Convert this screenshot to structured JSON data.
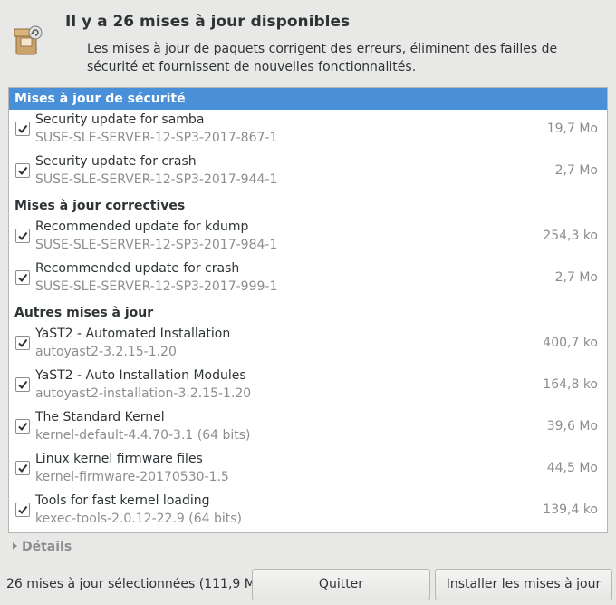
{
  "header": {
    "title": "Il y a 26 mises à jour disponibles",
    "description": "Les mises à jour de paquets corrigent des erreurs, éliminent des failles de sécurité et fournissent de nouvelles fonctionnalités.",
    "icon": "software-update-icon"
  },
  "groups": [
    {
      "title": "Mises à jour de sécurité",
      "selected": true,
      "items": [
        {
          "name": "Security update for samba",
          "id": "SUSE-SLE-SERVER-12-SP3-2017-867-1",
          "size": "19,7 Mo",
          "checked": true
        },
        {
          "name": "Security update for crash",
          "id": "SUSE-SLE-SERVER-12-SP3-2017-944-1",
          "size": "2,7 Mo",
          "checked": true
        }
      ]
    },
    {
      "title": "Mises à jour correctives",
      "selected": false,
      "items": [
        {
          "name": "Recommended update for kdump",
          "id": "SUSE-SLE-SERVER-12-SP3-2017-984-1",
          "size": "254,3 ko",
          "checked": true
        },
        {
          "name": "Recommended update for crash",
          "id": "SUSE-SLE-SERVER-12-SP3-2017-999-1",
          "size": "2,7 Mo",
          "checked": true
        }
      ]
    },
    {
      "title": "Autres mises à jour",
      "selected": false,
      "items": [
        {
          "name": "YaST2 - Automated Installation",
          "id": "autoyast2-3.2.15-1.20",
          "size": "400,7 ko",
          "checked": true
        },
        {
          "name": "YaST2 - Auto Installation Modules",
          "id": "autoyast2-installation-3.2.15-1.20",
          "size": "164,8 ko",
          "checked": true
        },
        {
          "name": "The Standard Kernel",
          "id": "kernel-default-4.4.70-3.1 (64 bits)",
          "size": "39,6 Mo",
          "checked": true
        },
        {
          "name": "Linux kernel firmware files",
          "id": "kernel-firmware-20170530-1.5",
          "size": "44,5 Mo",
          "checked": true
        },
        {
          "name": "Tools for fast kernel loading",
          "id": "kexec-tools-2.0.12-22.9 (64 bits)",
          "size": "139,4 ko",
          "checked": true
        }
      ]
    }
  ],
  "details_label": "Détails",
  "footer": {
    "status": "26 mises à jour sélectionnées (111,9 Mo)",
    "quit_label": "Quitter",
    "install_label": "Installer les mises à jour"
  },
  "colors": {
    "selection": "#4a90d9",
    "secondary_text": "#8b8e8f"
  }
}
